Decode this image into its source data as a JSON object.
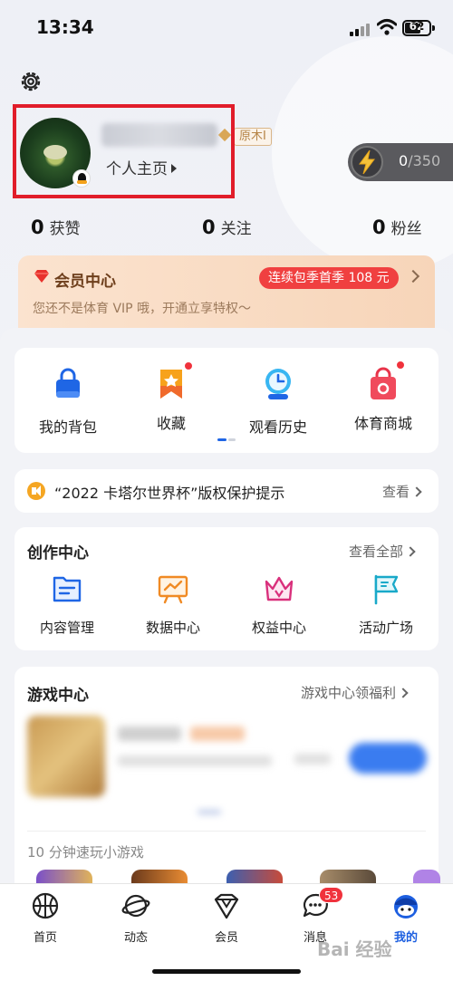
{
  "status_bar": {
    "time": "13:34",
    "battery": "62"
  },
  "profile": {
    "level_badge": "原木I",
    "homepage_link": "个人主页",
    "energy": {
      "current": "0",
      "max": "/350"
    }
  },
  "stats": [
    {
      "value": "0",
      "label": "获赞"
    },
    {
      "value": "0",
      "label": "关注"
    },
    {
      "value": "0",
      "label": "粉丝"
    }
  ],
  "vip": {
    "title": "会员中心",
    "subtitle": "您还不是体育 VIP 哦，开通立享特权～",
    "promo": "连续包季首季 108 元"
  },
  "quick_actions": [
    {
      "label": "我的背包",
      "icon": "bag-icon"
    },
    {
      "label": "收藏",
      "icon": "bookmark-star-icon"
    },
    {
      "label": "观看历史",
      "icon": "clock-icon"
    },
    {
      "label": "体育商城",
      "icon": "shop-bag-icon"
    }
  ],
  "notice": {
    "text": "“2022 卡塔尔世界杯”版权保护提示",
    "action": "查看"
  },
  "creation": {
    "title": "创作中心",
    "more": "查看全部",
    "items": [
      {
        "label": "内容管理",
        "icon": "folder-icon"
      },
      {
        "label": "数据中心",
        "icon": "chart-board-icon"
      },
      {
        "label": "权益中心",
        "icon": "crown-icon"
      },
      {
        "label": "活动广场",
        "icon": "flag-icon"
      }
    ]
  },
  "games": {
    "title": "游戏中心",
    "more": "游戏中心领福利",
    "mini_title": "10 分钟速玩小游戏"
  },
  "tabbar": {
    "badge": "53",
    "tabs": [
      {
        "label": "首页",
        "icon": "basketball-icon"
      },
      {
        "label": "动态",
        "icon": "planet-icon"
      },
      {
        "label": "会员",
        "icon": "diamond-icon"
      },
      {
        "label": "消息",
        "icon": "chat-bubble-icon"
      },
      {
        "label": "我的",
        "icon": "mascot-icon"
      }
    ]
  },
  "watermark": "Bai 经验"
}
